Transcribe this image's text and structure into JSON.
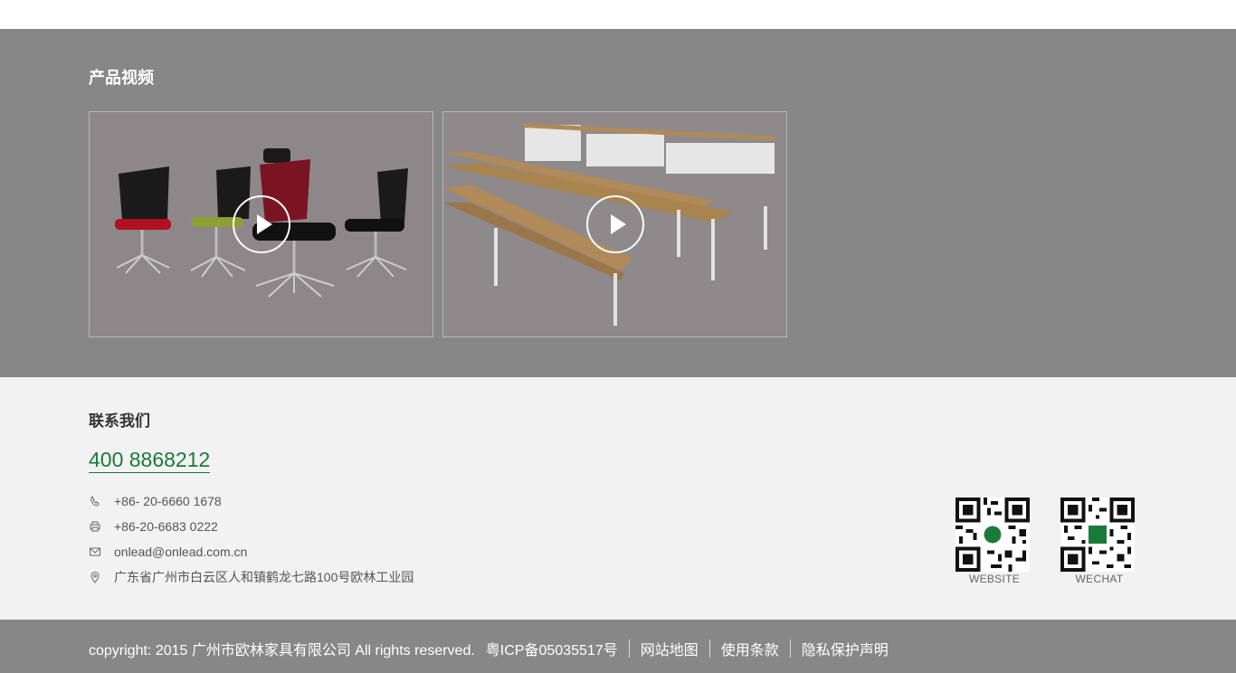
{
  "videos": {
    "title": "产品视频",
    "items": [
      {
        "name": "office-chairs-video"
      },
      {
        "name": "training-tables-video"
      }
    ]
  },
  "contact": {
    "title": "联系我们",
    "hotline": "400 8868212",
    "phone": "+86- 20-6660 1678",
    "fax": "+86-20-6683 0222",
    "email": "onlead@onlead.com.cn",
    "address": "广东省广州市白云区人和镇鹤龙七路100号欧林工业园",
    "icons": {
      "phone": "phone-icon",
      "fax": "printer-icon",
      "email": "mail-icon",
      "address": "location-pin-icon"
    },
    "qr_codes": [
      {
        "label": "WEBSITE"
      },
      {
        "label": "WECHAT"
      }
    ]
  },
  "footer": {
    "copyright": "copyright: 2015 广州市欧林家具有限公司 All rights reserved.",
    "icp": "粤ICP备05035517号",
    "links": [
      "网站地图",
      "使用条款",
      "隐私保护声明"
    ]
  },
  "colors": {
    "accent": "#1a7a3a",
    "dark_band": "#878787",
    "light_band": "#f2f2f2"
  }
}
